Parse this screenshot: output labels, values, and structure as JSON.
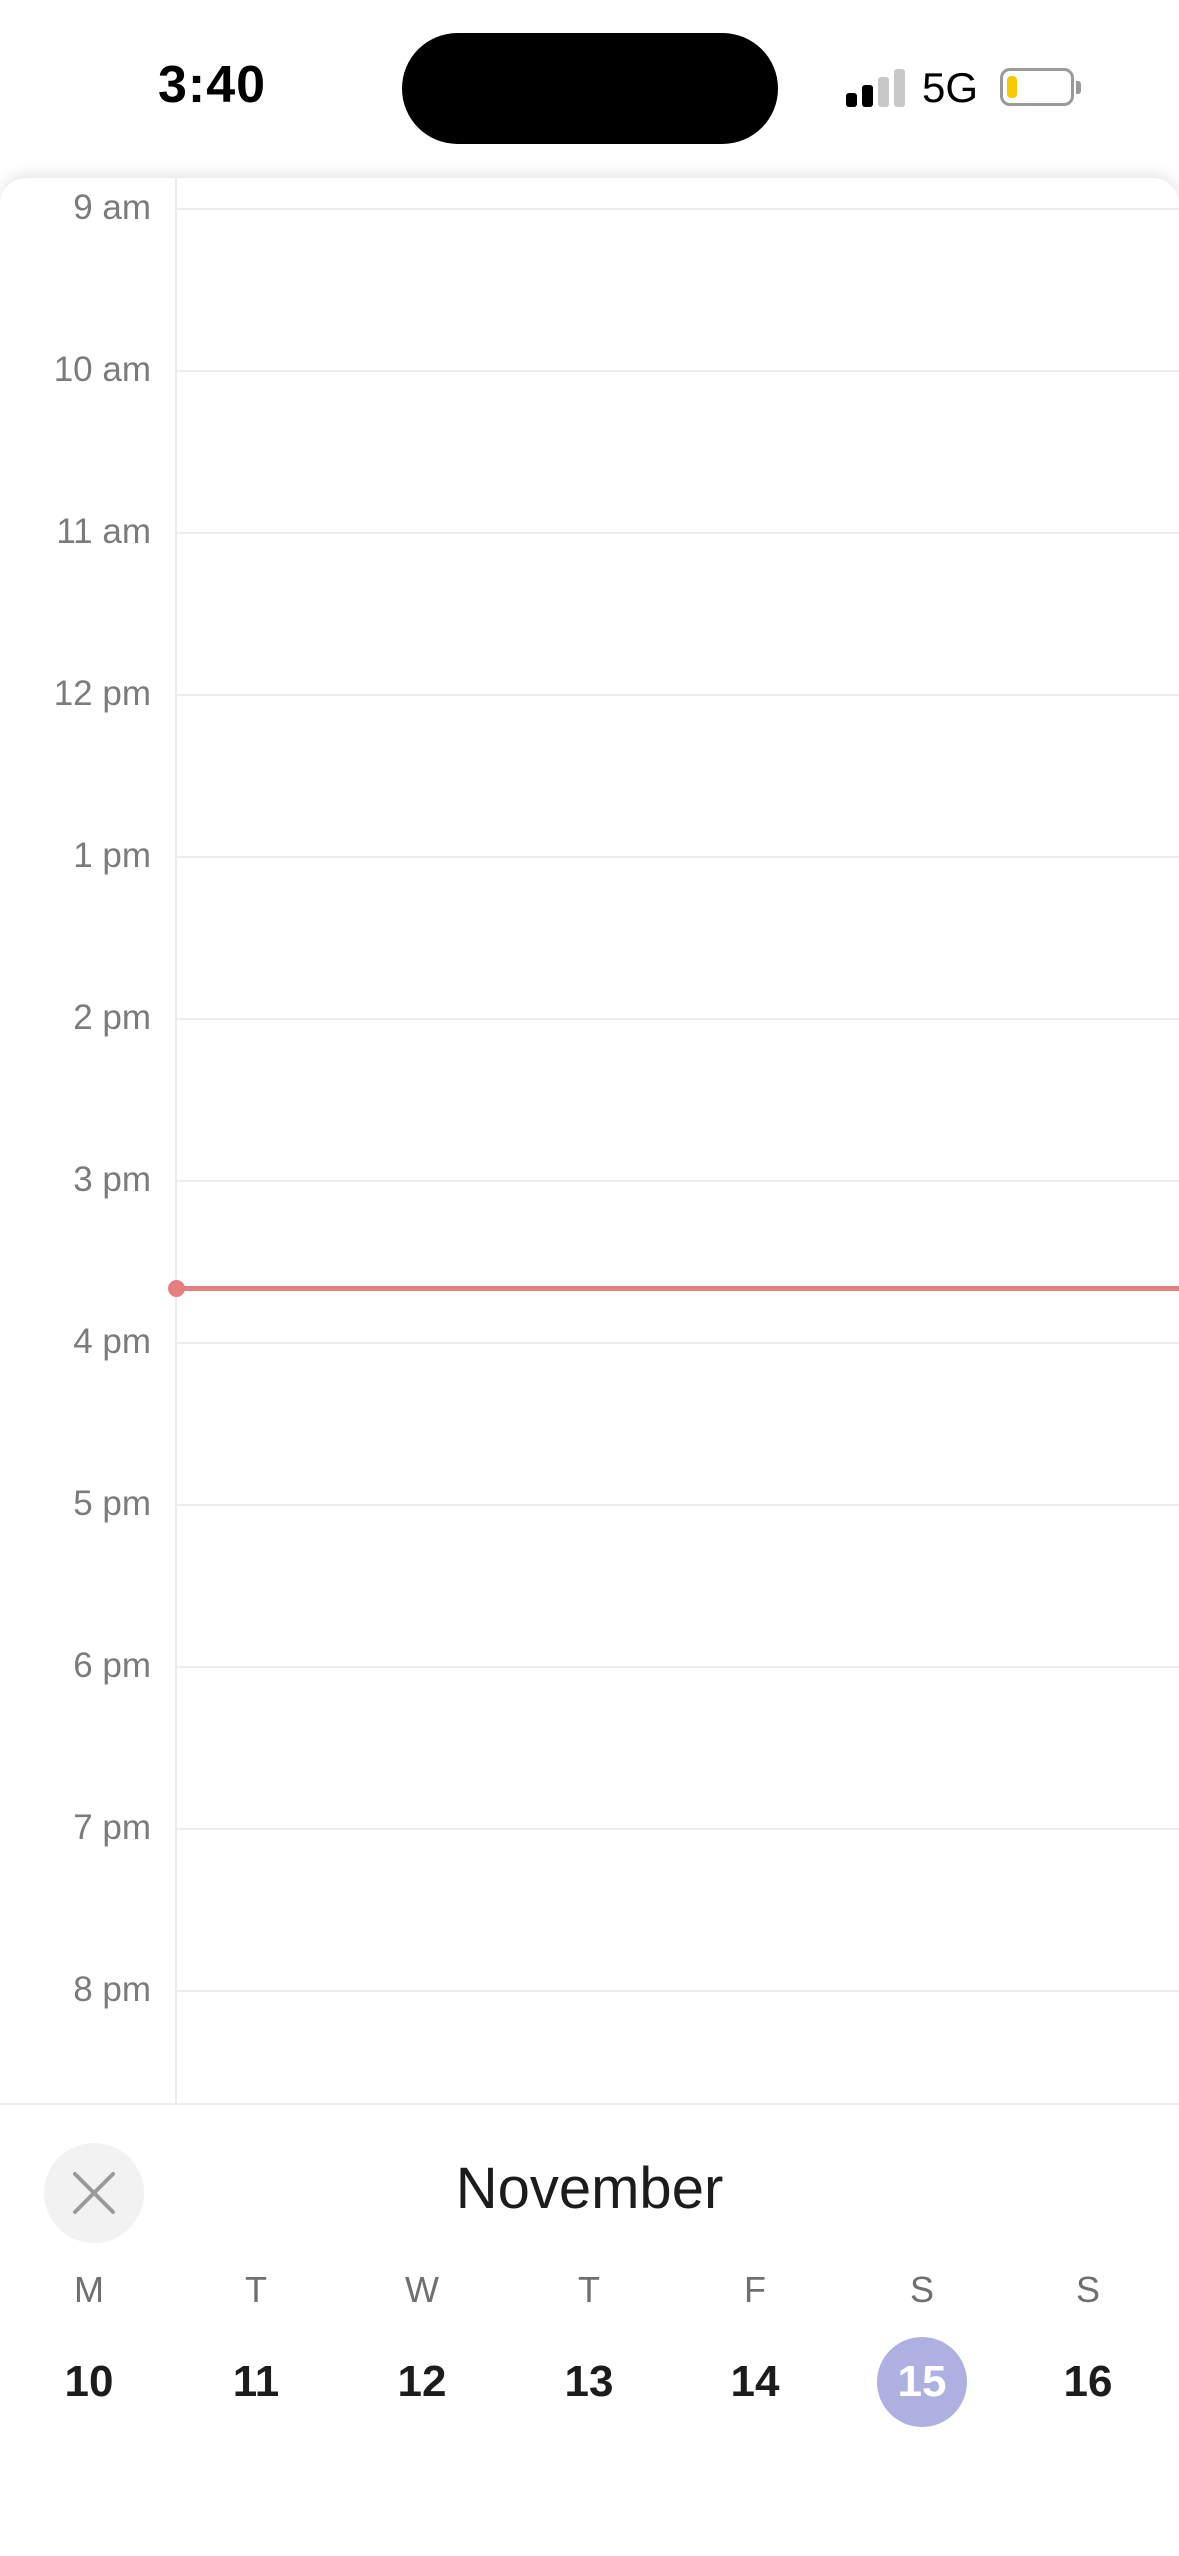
{
  "status_bar": {
    "time": "3:40",
    "network": "5G",
    "signal_bars_active": 2,
    "signal_bars_total": 4,
    "battery_level": "low",
    "battery_color": "#f7c900"
  },
  "calendar": {
    "hours": [
      "9 am",
      "10 am",
      "11 am",
      "12 pm",
      "1 pm",
      "2 pm",
      "3 pm",
      "4 pm",
      "5 pm",
      "6 pm",
      "7 pm",
      "8 pm"
    ],
    "current_time_indicator_color": "#e57f7f"
  },
  "week_picker": {
    "month": "November",
    "close_icon": "close-icon",
    "days": [
      {
        "dow": "M",
        "num": "10",
        "selected": false
      },
      {
        "dow": "T",
        "num": "11",
        "selected": false
      },
      {
        "dow": "W",
        "num": "12",
        "selected": false
      },
      {
        "dow": "T",
        "num": "13",
        "selected": false
      },
      {
        "dow": "F",
        "num": "14",
        "selected": false
      },
      {
        "dow": "S",
        "num": "15",
        "selected": true
      },
      {
        "dow": "S",
        "num": "16",
        "selected": false
      }
    ],
    "selected_color": "#aeb0e2"
  }
}
